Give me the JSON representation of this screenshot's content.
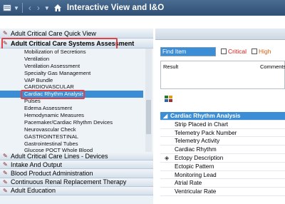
{
  "titlebar": {
    "title": "Interactive View and I&O",
    "icons": [
      "menu-icon",
      "back-arrow-icon",
      "forward-arrow-icon",
      "home-icon"
    ]
  },
  "left_panel": {
    "top_sections": [
      {
        "label": "Adult Critical Care Quick View",
        "boxed": false
      },
      {
        "label": "Adult Critical Care Systems Assessment",
        "boxed": true
      }
    ],
    "items": [
      "Mobilization of Secretions",
      "Ventilation",
      "Ventilation Assessment",
      "Specialty Gas Management",
      "VAP Bundle",
      "CARDIOVASCULAR",
      "Cardiac Rhythm Analysis",
      "Pulses",
      "Edema Assessment",
      "Hemodynamic Measures",
      "Pacemaker/Cardiac Rhythm Devices",
      "Neurovascular Check",
      "GASTROINTESTINAL",
      "Gastrointestinal Tubes",
      "Glucose POCT Whole Blood"
    ],
    "selected_index": 6,
    "bottom_sections": [
      "Adult Critical Care Lines - Devices",
      "Intake And Output",
      "Blood Product Administration",
      "Continuous Renal Replacement Therapy",
      "Adult Education"
    ]
  },
  "right_panel": {
    "find_item_placeholder": "Find Item",
    "filters": [
      {
        "label": "Critical",
        "color": "#d01818"
      },
      {
        "label": "High",
        "color": "#d06010"
      }
    ],
    "columns": {
      "result": "Result",
      "comments": "Comments"
    },
    "section_header": "Cardiac Rhythm Analysis",
    "rows": [
      "Strip Placed in Chart",
      "Telemetry Pack Number",
      "Telemetry Activity",
      "Cardiac Rhythm",
      "Ectopy Description",
      "Ectopic Pattern",
      "Monitoring Lead",
      "Atrial Rate",
      "Ventricular Rate"
    ],
    "row_icon_index": 4
  },
  "colors": {
    "titlebar": "#2f4f73",
    "selection": "#3b8ed6",
    "highlight_box": "#e0424a"
  }
}
